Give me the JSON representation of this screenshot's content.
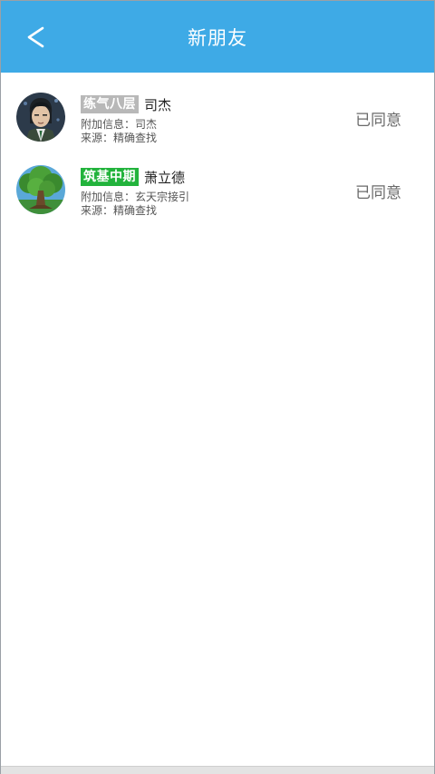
{
  "header": {
    "title": "新朋友",
    "back_icon": "chevron-left-icon",
    "background_color": "#3eaae6"
  },
  "requests": [
    {
      "avatar": "portrait-avatar",
      "badge": "练气八层",
      "badge_color": "#b8b8b8",
      "name": "司杰",
      "extra_info": "附加信息：司杰",
      "source": "来源：精确查找",
      "status": "已同意"
    },
    {
      "avatar": "tree-avatar",
      "badge": "筑基中期",
      "badge_color": "#22b33c",
      "name": "萧立德",
      "extra_info": "附加信息：玄天宗接引",
      "source": "来源：精确查找",
      "status": "已同意"
    }
  ]
}
